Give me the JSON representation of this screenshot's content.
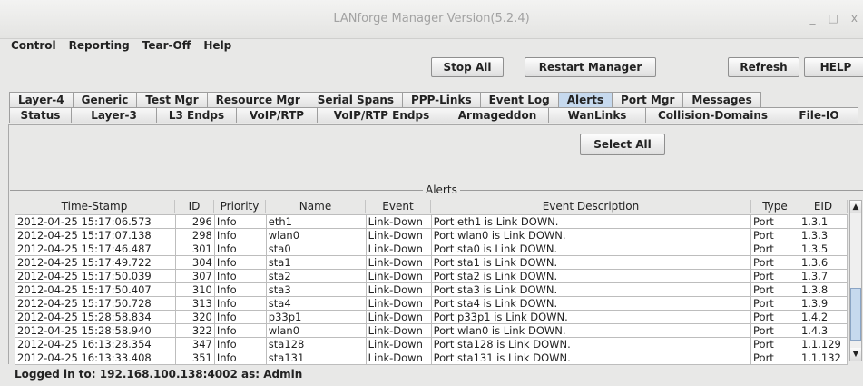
{
  "window": {
    "title": "LANforge Manager   Version(5.2.4)",
    "minimize": "_",
    "maximize": "□",
    "close": "x"
  },
  "menu": [
    "Control",
    "Reporting",
    "Tear-Off",
    "Help"
  ],
  "toolbar": {
    "stop_all": "Stop All",
    "restart_manager": "Restart Manager",
    "refresh": "Refresh",
    "help": "HELP"
  },
  "tabs_row1": [
    "Layer-4",
    "Generic",
    "Test Mgr",
    "Resource Mgr",
    "Serial Spans",
    "PPP-Links",
    "Event Log",
    "Alerts",
    "Port Mgr",
    "Messages"
  ],
  "tabs_row2": [
    "Status",
    "Layer-3",
    "L3 Endps",
    "VoIP/RTP",
    "VoIP/RTP Endps",
    "Armageddon",
    "WanLinks",
    "Collision-Domains",
    "File-IO"
  ],
  "active_tab": "Alerts",
  "select_all": "Select All",
  "alerts_title": "Alerts",
  "columns": [
    "Time-Stamp",
    "ID",
    "Priority",
    "Name",
    "Event",
    "Event Description",
    "Type",
    "EID"
  ],
  "rows": [
    [
      "2012-04-25 15:17:06.573",
      "296",
      "Info",
      "eth1",
      "Link-Down",
      "Port eth1 is Link DOWN.",
      "Port",
      "1.3.1"
    ],
    [
      "2012-04-25 15:17:07.138",
      "298",
      "Info",
      "wlan0",
      "Link-Down",
      "Port wlan0 is Link DOWN.",
      "Port",
      "1.3.3"
    ],
    [
      "2012-04-25 15:17:46.487",
      "301",
      "Info",
      "sta0",
      "Link-Down",
      "Port sta0 is Link DOWN.",
      "Port",
      "1.3.5"
    ],
    [
      "2012-04-25 15:17:49.722",
      "304",
      "Info",
      "sta1",
      "Link-Down",
      "Port sta1 is Link DOWN.",
      "Port",
      "1.3.6"
    ],
    [
      "2012-04-25 15:17:50.039",
      "307",
      "Info",
      "sta2",
      "Link-Down",
      "Port sta2 is Link DOWN.",
      "Port",
      "1.3.7"
    ],
    [
      "2012-04-25 15:17:50.407",
      "310",
      "Info",
      "sta3",
      "Link-Down",
      "Port sta3 is Link DOWN.",
      "Port",
      "1.3.8"
    ],
    [
      "2012-04-25 15:17:50.728",
      "313",
      "Info",
      "sta4",
      "Link-Down",
      "Port sta4 is Link DOWN.",
      "Port",
      "1.3.9"
    ],
    [
      "2012-04-25 15:28:58.834",
      "320",
      "Info",
      "p33p1",
      "Link-Down",
      "Port p33p1 is Link DOWN.",
      "Port",
      "1.4.2"
    ],
    [
      "2012-04-25 15:28:58.940",
      "322",
      "Info",
      "wlan0",
      "Link-Down",
      "Port wlan0 is Link DOWN.",
      "Port",
      "1.4.3"
    ],
    [
      "2012-04-25 16:13:28.354",
      "347",
      "Info",
      "sta128",
      "Link-Down",
      "Port sta128 is Link DOWN.",
      "Port",
      "1.1.129"
    ],
    [
      "2012-04-25 16:13:33.408",
      "351",
      "Info",
      "sta131",
      "Link-Down",
      "Port sta131 is Link DOWN.",
      "Port",
      "1.1.132"
    ]
  ],
  "status": "Logged in to:  192.168.100.138:4002  as:  Admin",
  "colors": {
    "active_tab": "#c6d9ee",
    "background": "#e8e8e7"
  }
}
